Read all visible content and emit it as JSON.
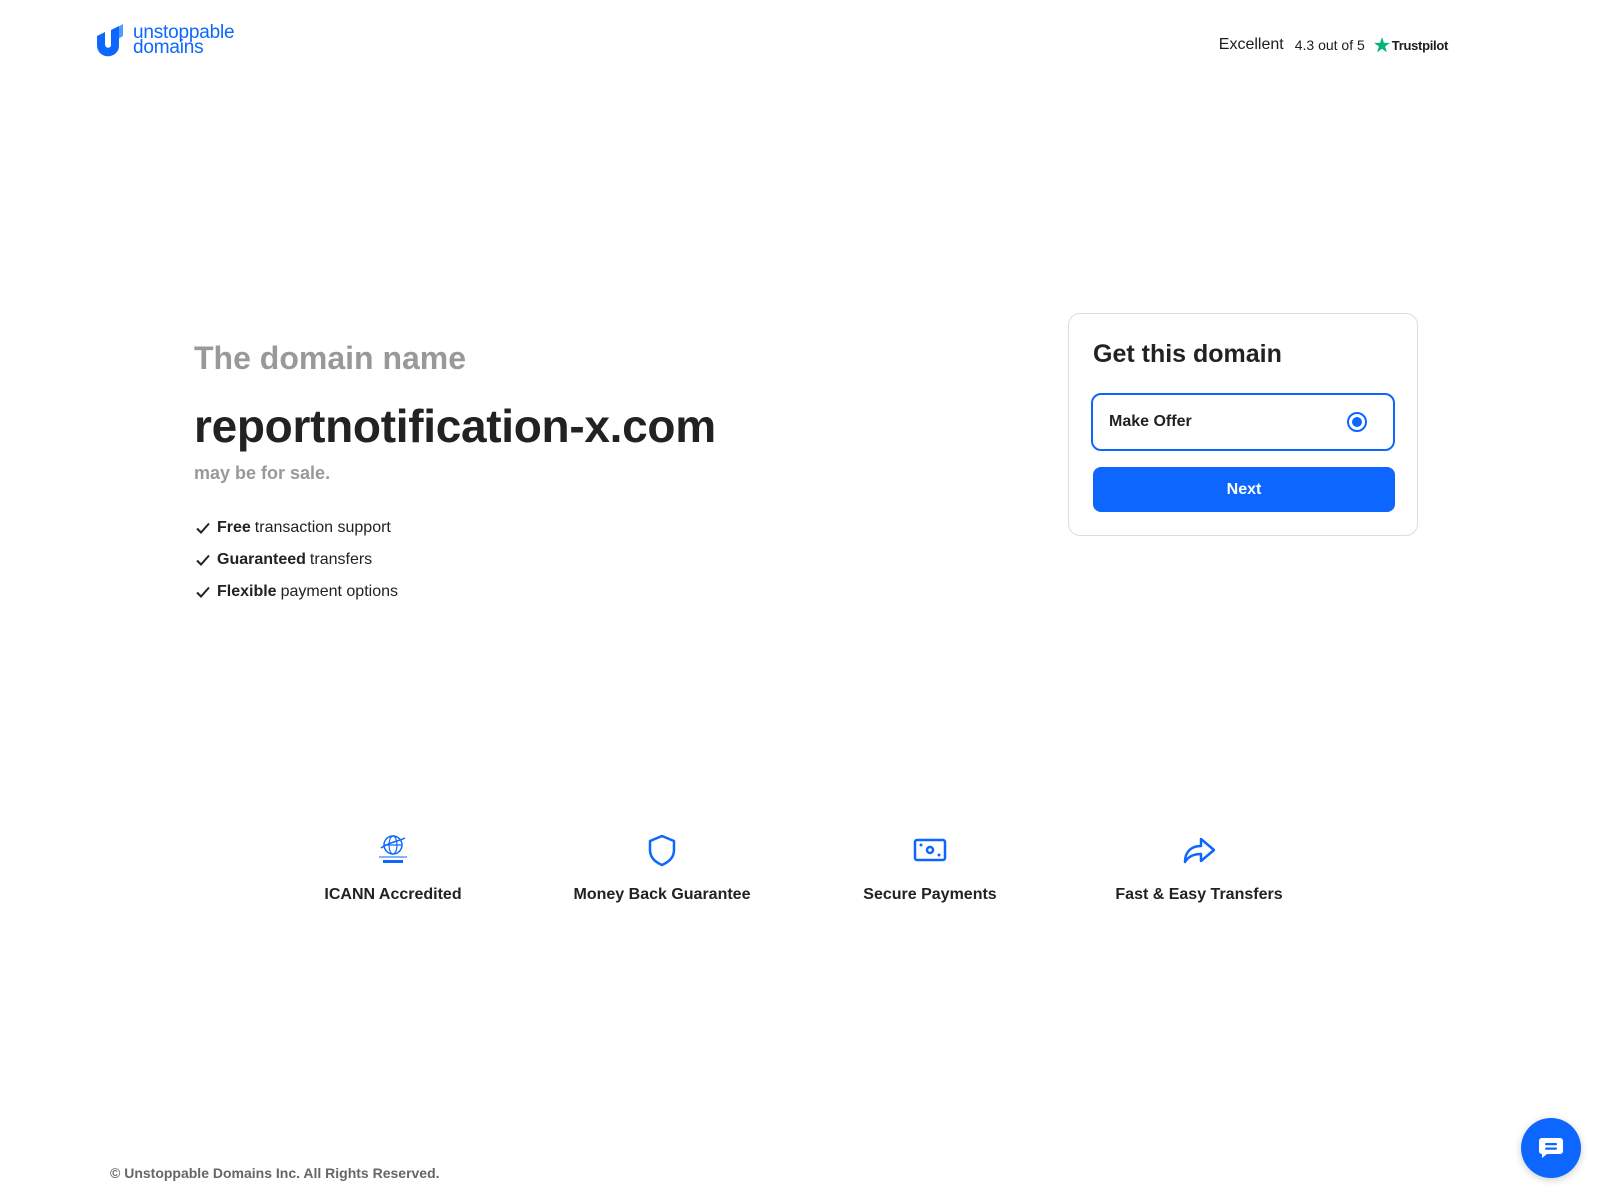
{
  "brand": {
    "line1": "unstoppable",
    "line2": "domains",
    "color": "#0d67fe"
  },
  "trustpilot": {
    "rating_word": "Excellent",
    "score": "4.3 out of 5",
    "brand": "Trustpilot",
    "star_color": "#00b67a"
  },
  "hero": {
    "subtitle": "The domain name",
    "domain": "reportnotification-x.com",
    "sale_text": "may be for sale.",
    "features": [
      {
        "bold": "Free",
        "rest": "transaction support"
      },
      {
        "bold": "Guaranteed",
        "rest": "transfers"
      },
      {
        "bold": "Flexible",
        "rest": "payment options"
      }
    ]
  },
  "card": {
    "title": "Get this domain",
    "option_label": "Make Offer",
    "option_selected": true,
    "next_label": "Next"
  },
  "badges": [
    {
      "label": "ICANN Accredited",
      "icon": "icann-icon"
    },
    {
      "label": "Money Back Guarantee",
      "icon": "shield-icon"
    },
    {
      "label": "Secure Payments",
      "icon": "payment-icon"
    },
    {
      "label": "Fast & Easy Transfers",
      "icon": "share-arrow-icon"
    }
  ],
  "footer": {
    "copyright": "© Unstoppable Domains Inc. All Rights Reserved."
  },
  "chat": {
    "icon": "chat-icon"
  }
}
